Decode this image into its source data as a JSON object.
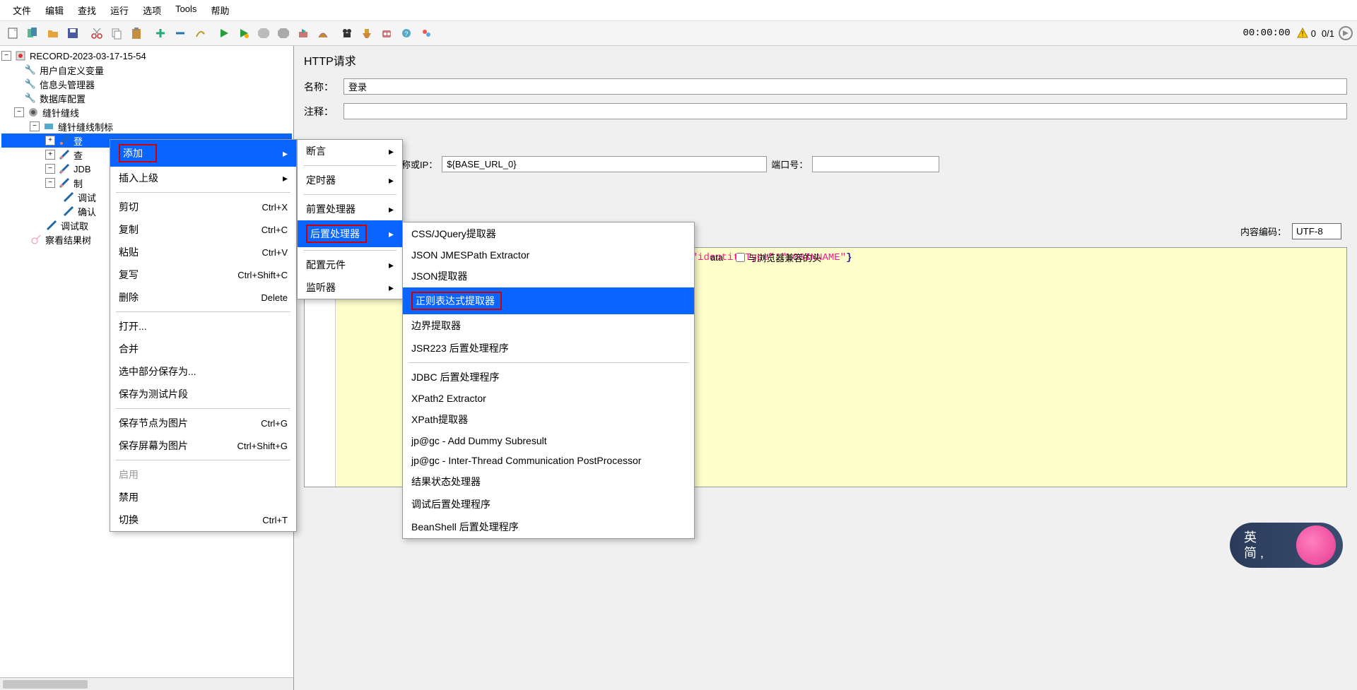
{
  "menubar": [
    "文件",
    "编辑",
    "查找",
    "运行",
    "选项",
    "Tools",
    "帮助"
  ],
  "timer": "00:00:00",
  "warn_count": "0",
  "thread_count": "0/1",
  "tree": {
    "root": "RECORD-2023-03-17-15-54",
    "n1": "用户自定义变量",
    "n2": "信息头管理器",
    "n3": "数据库配置",
    "n4": "缝针缝线",
    "n5": "缝针缝线制标",
    "n6": "登",
    "n7": "查",
    "n8": "JDB",
    "n9": "制",
    "n10": "调试",
    "n11": "确认",
    "n12": "调试取",
    "n13": "察看结果树"
  },
  "ctx1": {
    "add": "添加",
    "insertParent": "插入上级",
    "cut": "剪切",
    "cut_k": "Ctrl+X",
    "copy": "复制",
    "copy_k": "Ctrl+C",
    "paste": "粘贴",
    "paste_k": "Ctrl+V",
    "duplicate": "复写",
    "duplicate_k": "Ctrl+Shift+C",
    "delete": "删除",
    "delete_k": "Delete",
    "open": "打开...",
    "merge": "合并",
    "saveSel": "选中部分保存为...",
    "saveFrag": "保存为测试片段",
    "saveNodeImg": "保存节点为图片",
    "saveNodeImg_k": "Ctrl+G",
    "saveScreenImg": "保存屏幕为图片",
    "saveScreenImg_k": "Ctrl+Shift+G",
    "enable": "启用",
    "disable": "禁用",
    "toggle": "切换",
    "toggle_k": "Ctrl+T"
  },
  "ctx2": {
    "assert": "断言",
    "timer": "定时器",
    "pre": "前置处理器",
    "post": "后置处理器",
    "config": "配置元件",
    "listener": "监听器"
  },
  "ctx3": {
    "css": "CSS/JQuery提取器",
    "jmes": "JSON JMESPath Extractor",
    "json": "JSON提取器",
    "regex": "正则表达式提取器",
    "boundary": "边界提取器",
    "jsr223": "JSR223 后置处理程序",
    "jdbc": "JDBC 后置处理程序",
    "xpath2": "XPath2 Extractor",
    "xpath": "XPath提取器",
    "dummy": "jp@gc - Add Dummy Subresult",
    "inter": "jp@gc - Inter-Thread Communication PostProcessor",
    "result": "结果状态处理器",
    "debug": "调试后置处理程序",
    "bean": "BeanShell 后置处理程序"
  },
  "panel": {
    "title": "HTTP请求",
    "name_lbl": "名称：",
    "name_val": "登录",
    "comment_lbl": "注释：",
    "server_lbl": "服务器名称或IP：",
    "server_val": "${BASE_URL_0}",
    "port_lbl": "端口号：",
    "port_val": "",
    "enc_lbl": "内容编码：",
    "enc_val": "UTF-8",
    "chk_data": "ata",
    "chk_browser": "与浏览器兼容的头",
    "code_text": "\"identityType\":\"LOGINNAME\"",
    "code_prefix": "iden"
  },
  "badge": {
    "line1": "英",
    "line2": "简 ,"
  }
}
